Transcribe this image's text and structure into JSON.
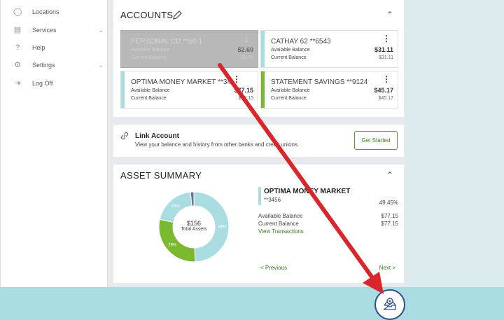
{
  "sidebar": {
    "items": [
      {
        "label": "Locations",
        "icon": "location-pin-icon",
        "chevron": false
      },
      {
        "label": "Services",
        "icon": "services-icon",
        "chevron": true
      },
      {
        "label": "Help",
        "icon": "help-icon",
        "chevron": false
      },
      {
        "label": "Settings",
        "icon": "gear-icon",
        "chevron": true
      },
      {
        "label": "Log Off",
        "icon": "logoff-icon",
        "chevron": false
      }
    ]
  },
  "accounts": {
    "title": "ACCOUNTS",
    "items": [
      {
        "name": "PERSONAL CD **58-1",
        "avail_label": "Available Balance",
        "avail": "$2.60",
        "curr_label": "Current Balance",
        "curr": "$2.60",
        "color": "#a9dde2",
        "greyed": true
      },
      {
        "name": "CATHAY 62 **6543",
        "avail_label": "Available Balance",
        "avail": "$31.11",
        "curr_label": "Current Balance",
        "curr": "$31.11",
        "color": "#a9dde2",
        "greyed": false
      },
      {
        "name": "OPTIMA MONEY MARKET **3456",
        "avail_label": "Available Balance",
        "avail": "$77.15",
        "curr_label": "Current Balance",
        "curr": "$77.15",
        "color": "#a9dde2",
        "greyed": false
      },
      {
        "name": "STATEMENT SAVINGS **9124",
        "avail_label": "Available Balance",
        "avail": "$45.17",
        "curr_label": "Current Balance",
        "curr": "$45.17",
        "color": "#7ab82e",
        "greyed": false
      }
    ]
  },
  "link": {
    "title": "Link Account",
    "desc": "View your balance and history from other banks and credit unions.",
    "button": "Get Started"
  },
  "asset_summary": {
    "title": "ASSET SUMMARY",
    "total": "$156",
    "total_label": "Total Assets",
    "segments": [
      {
        "label": "49%",
        "value": 49.45,
        "color": "#a9dde2"
      },
      {
        "label": "29%",
        "value": 29,
        "color": "#7ab82e"
      },
      {
        "label": "20%",
        "value": 20,
        "color": "#a9dde2"
      },
      {
        "label": "",
        "value": 1.55,
        "color": "#6a6f8a"
      }
    ],
    "selected": {
      "name": "OPTIMA MONEY MARKET",
      "number": "**3456",
      "percent": "49.45%",
      "avail_label": "Available Balance",
      "avail": "$77.15",
      "curr_label": "Current Balance",
      "curr": "$77.15",
      "view_link": "View Transactions"
    },
    "prev": "< Previous",
    "next": "Next >"
  }
}
